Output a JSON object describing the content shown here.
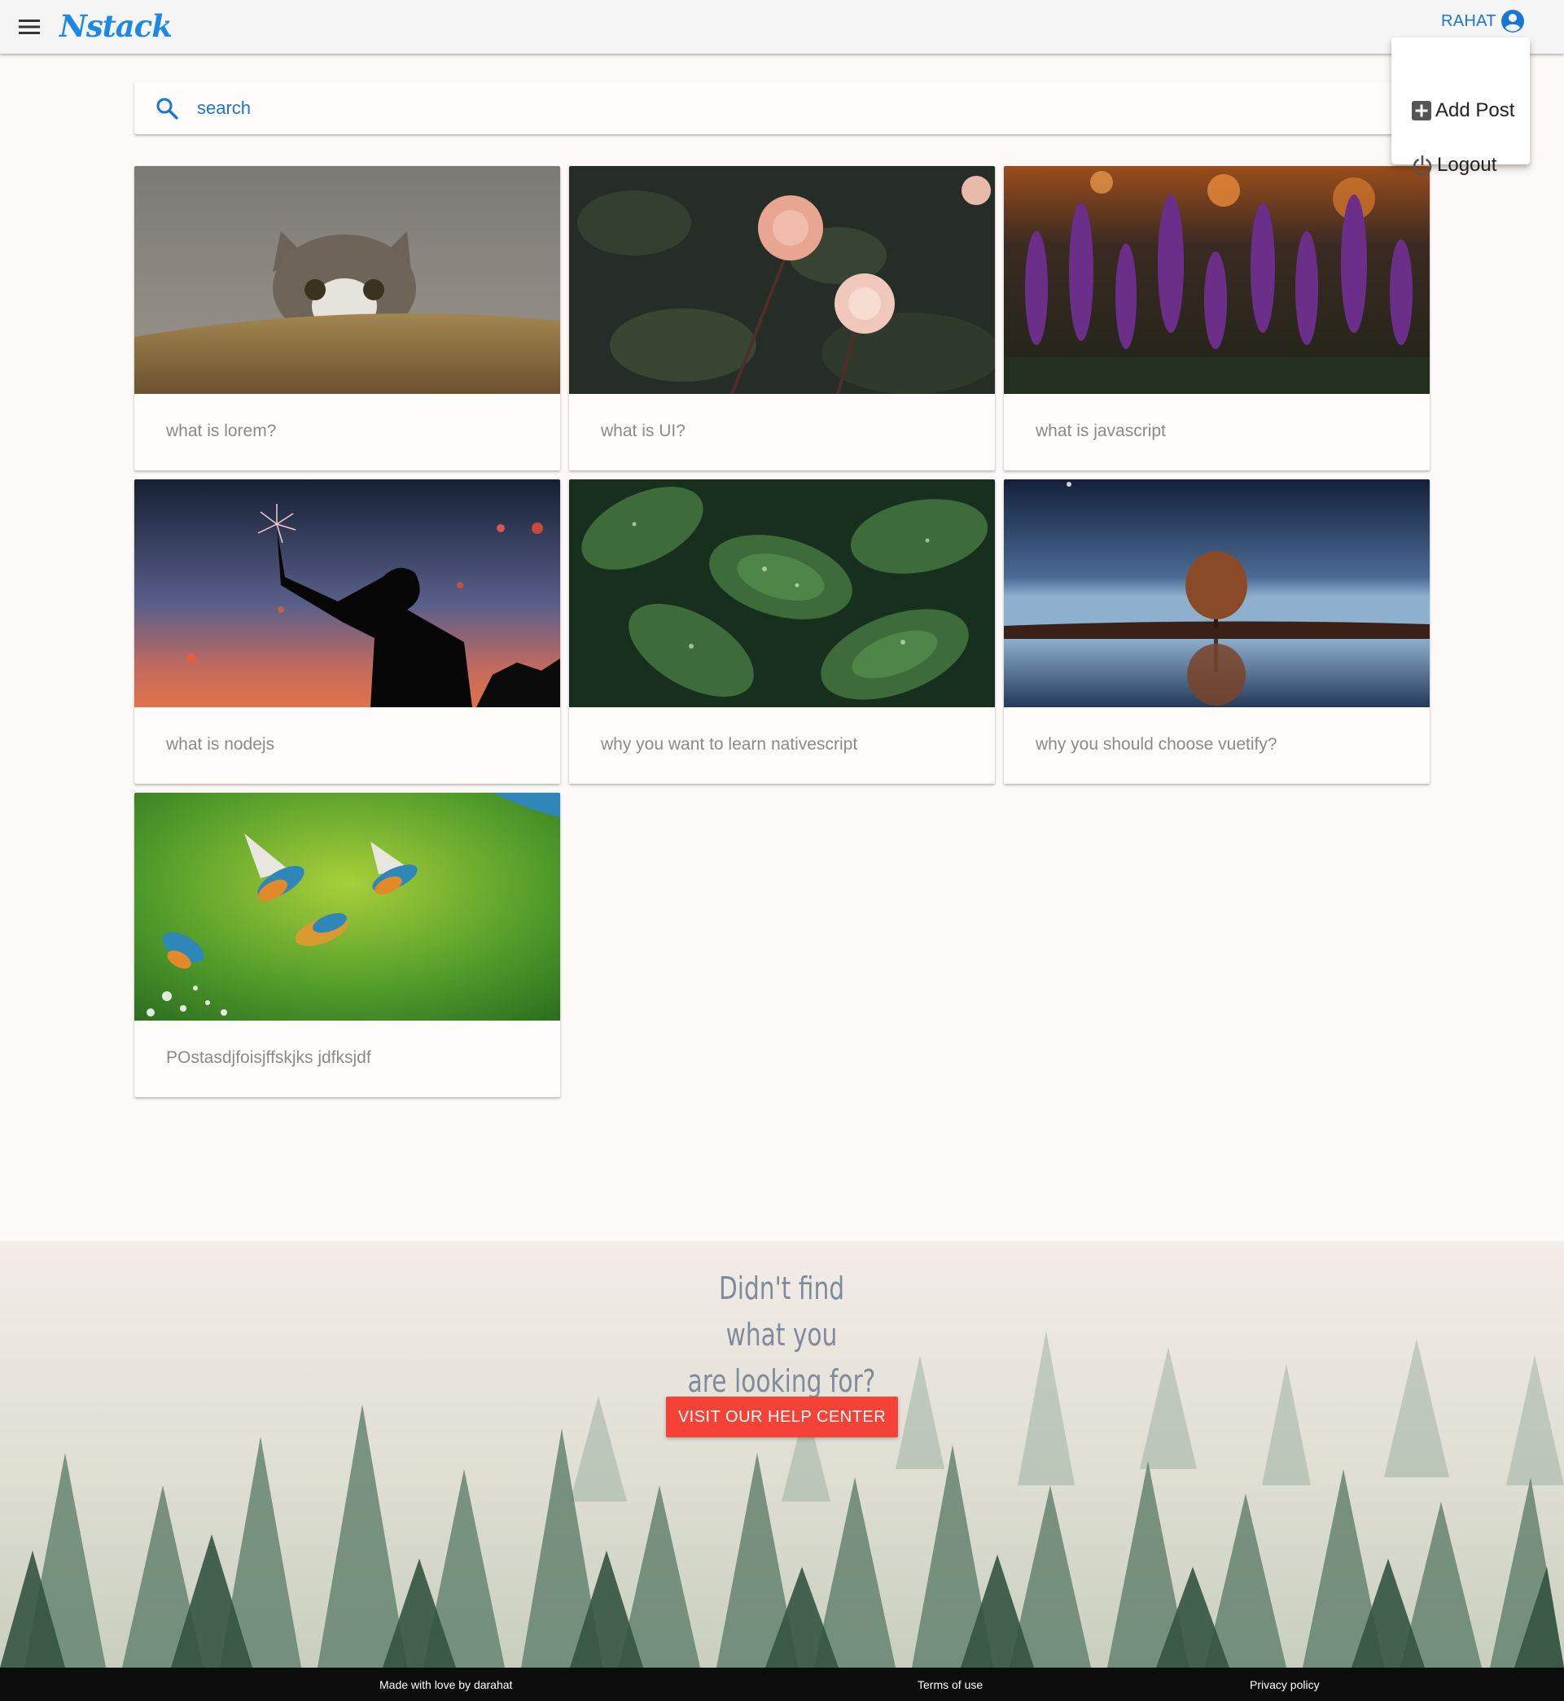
{
  "app": {
    "logo_text": "Nstack",
    "user_name": "RAHAT",
    "accent_color": "#1976d2"
  },
  "user_menu": {
    "items": [
      {
        "label": "Add Post",
        "icon": "plus-box-icon"
      },
      {
        "label": "Logout",
        "icon": "power-icon"
      }
    ]
  },
  "search": {
    "placeholder": "search",
    "icon": "search-icon"
  },
  "posts": [
    {
      "title": "what is lorem?",
      "image": "kitten-photo"
    },
    {
      "title": "what is UI?",
      "image": "roses-photo"
    },
    {
      "title": "what is javascript",
      "image": "lupine-flowers-photo"
    },
    {
      "title": "what is nodejs",
      "image": "sparkler-silhouette-photo"
    },
    {
      "title": "why you want to learn nativescript",
      "image": "green-leaves-photo"
    },
    {
      "title": "why you should choose vuetify?",
      "image": "tree-reflection-photo"
    },
    {
      "title": "POstasdjfoisjffskjks jdfksjdf",
      "image": "kingfishers-photo"
    }
  ],
  "help": {
    "heading_line1": "Didn't find what you",
    "heading_line2": "are looking for?",
    "button_label": "VISIT OUR HELP CENTER",
    "button_color": "#f44336"
  },
  "footer": {
    "credit": "Made with love by darahat",
    "terms": "Terms of use",
    "privacy": "Privacy policy"
  }
}
